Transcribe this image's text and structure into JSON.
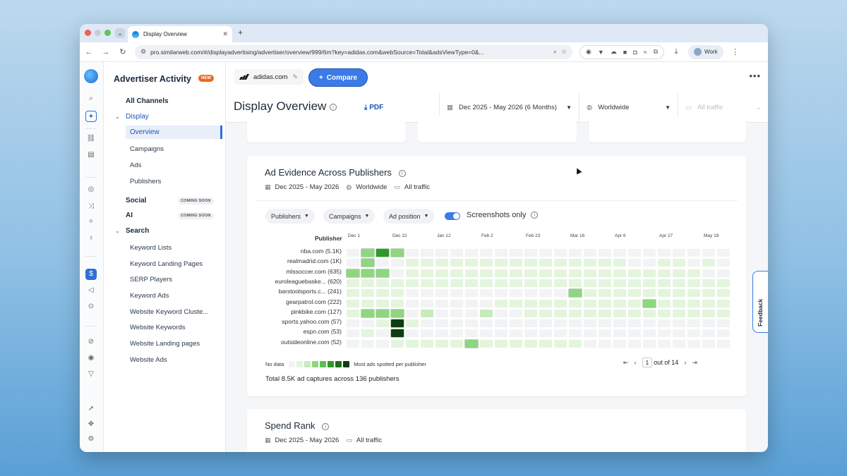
{
  "browser": {
    "tab_title": "Display Overview",
    "tab_close": "✕",
    "new_tab": "+",
    "url": "pro.similarweb.com/#/displayadvertising/advertiser/overview/999/6m?key=adidas.com&webSource=Total&adsViewType=0&...",
    "profile_label": "Work"
  },
  "rail": {
    "icons": [
      "logo",
      "search-icon",
      "sparkle-icon",
      "link-icon",
      "report-icon",
      "eye-icon",
      "shuffle-icon",
      "ai-icon",
      "bulb-icon",
      "display-ads-icon",
      "megaphone-icon",
      "search-doc-icon",
      "keyword-icon",
      "target-icon",
      "funnel-icon",
      "rocket-icon",
      "puzzle-icon",
      "gear-icon"
    ]
  },
  "sidebar": {
    "title": "Advertiser Activity",
    "new_badge": "NEW",
    "all_channels": "All Channels",
    "display": "Display",
    "display_items": [
      "Overview",
      "Campaigns",
      "Ads",
      "Publishers"
    ],
    "social": "Social",
    "ai": "AI",
    "coming_soon": "COMING SOON",
    "search": "Search",
    "search_items": [
      "Keyword Lists",
      "Keyword Landing Pages",
      "SERP Players",
      "Keyword Ads",
      "Website Keyword Cluste...",
      "Website Keywords",
      "Website Landing pages",
      "Website Ads"
    ]
  },
  "header": {
    "domain": "adidas.com",
    "compare_label": "Compare",
    "page_title": "Display Overview",
    "pdf_label": "PDF",
    "date_filter": "Dec 2025 - May 2026 (6 Months)",
    "country_filter": "Worldwide",
    "traffic_filter": "All traffic"
  },
  "ad_evidence": {
    "title": "Ad Evidence Across Publishers",
    "date_range": "Dec 2025 - May 2026",
    "country": "Worldwide",
    "traffic": "All traffic",
    "dropdowns": [
      "Publishers",
      "Campaigns",
      "Ad position"
    ],
    "toggle_label": "Screenshots only",
    "toggle_on": true,
    "publisher_header": "Publisher",
    "dates": [
      "Dec 1",
      "Dec 22",
      "Jan 12",
      "Feb 2",
      "Feb 23",
      "Mar 16",
      "Apr 6",
      "Apr 27",
      "May 18"
    ],
    "publishers": [
      "nba.com (5.1K)",
      "realmadrid.com (1K)",
      "mlssoccer.com (635)",
      "euroleaguebaske... (620)",
      "barstoolsports.c... (241)",
      "gearpatrol.com (222)",
      "pinkbike.com (127)",
      "sports.yahoo.com (57)",
      "espn.com (53)",
      "outsideonline.com (52)"
    ],
    "heatmap_levels": [
      [
        0,
        3,
        5,
        3,
        0,
        0,
        0,
        0,
        0,
        0,
        0,
        0,
        0,
        0,
        0,
        0,
        0,
        0,
        0,
        0,
        0,
        0,
        0,
        0,
        0,
        0
      ],
      [
        0,
        3,
        0,
        0,
        1,
        1,
        1,
        1,
        1,
        1,
        1,
        1,
        1,
        1,
        1,
        1,
        1,
        1,
        1,
        0,
        0,
        1,
        1,
        0,
        1,
        0
      ],
      [
        3,
        3,
        3,
        0,
        1,
        1,
        1,
        1,
        1,
        1,
        1,
        1,
        1,
        1,
        1,
        1,
        1,
        1,
        1,
        1,
        1,
        1,
        1,
        1,
        0,
        0
      ],
      [
        1,
        1,
        1,
        1,
        1,
        1,
        1,
        1,
        1,
        1,
        1,
        1,
        1,
        1,
        1,
        1,
        1,
        1,
        1,
        1,
        1,
        1,
        1,
        1,
        1,
        1
      ],
      [
        1,
        1,
        1,
        1,
        0,
        0,
        0,
        0,
        0,
        0,
        0,
        0,
        0,
        0,
        0,
        3,
        1,
        1,
        1,
        1,
        1,
        1,
        1,
        1,
        1,
        1
      ],
      [
        1,
        1,
        1,
        1,
        0,
        0,
        0,
        0,
        0,
        0,
        1,
        1,
        1,
        1,
        1,
        1,
        1,
        1,
        1,
        1,
        3,
        1,
        1,
        1,
        1,
        1
      ],
      [
        1,
        3,
        3,
        3,
        0,
        2,
        0,
        0,
        0,
        2,
        0,
        0,
        1,
        1,
        1,
        1,
        1,
        1,
        1,
        1,
        1,
        1,
        1,
        1,
        1,
        1
      ],
      [
        0,
        0,
        1,
        7,
        1,
        0,
        0,
        0,
        0,
        0,
        0,
        0,
        0,
        0,
        0,
        0,
        0,
        0,
        0,
        0,
        0,
        0,
        0,
        0,
        0,
        0
      ],
      [
        0,
        1,
        0,
        7,
        0,
        0,
        0,
        0,
        0,
        0,
        0,
        0,
        0,
        0,
        0,
        0,
        0,
        0,
        0,
        0,
        0,
        0,
        0,
        0,
        0,
        0
      ],
      [
        0,
        0,
        0,
        1,
        1,
        1,
        1,
        1,
        3,
        1,
        1,
        1,
        1,
        1,
        1,
        1,
        0,
        0,
        0,
        0,
        0,
        0,
        0,
        0,
        0,
        0
      ]
    ],
    "legend_no_data": "No data",
    "legend_max": "Most ads spotted per publisher",
    "total_text": "Total 8.5K ad captures across 136 publishers",
    "page_current": "1",
    "page_total_label": "out of 14"
  },
  "spend_rank": {
    "title": "Spend Rank",
    "date_range": "Dec 2025 - May 2026",
    "traffic": "All traffic"
  },
  "feedback_label": "Feedback",
  "colors": {
    "accent": "#3b7be8",
    "heat": [
      "#f2f3f4",
      "#e3f5dd",
      "#c7ebbb",
      "#8fd680",
      "#5cc04f",
      "#2f9a2a",
      "#1c6f1c",
      "#0f3d12"
    ]
  }
}
